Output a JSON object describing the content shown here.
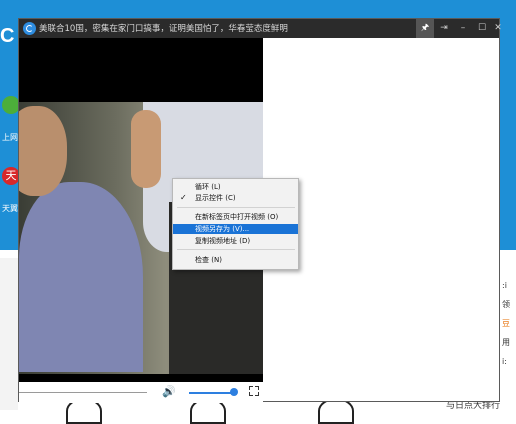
{
  "background": {
    "logo": "C",
    "apps": [
      {
        "label": "上网",
        "icon": "green-app-icon"
      },
      {
        "label": "天翼",
        "glyph": "天",
        "icon": "red-app-icon"
      }
    ],
    "right_column": [
      ":i",
      "领",
      "豆",
      "用",
      "i:"
    ],
    "bottom_text": "与日点大排行"
  },
  "window": {
    "title": "美联合10国，密集在家门口搞事，证明美国怕了，华春莹态度鲜明",
    "buttons": {
      "pin": "🖈",
      "exit": "⇥",
      "minimize": "–",
      "maximize": "☐",
      "close": "✕"
    }
  },
  "player": {
    "volume_icon": "🔊",
    "volume_level": 0.95,
    "progress": 0.0
  },
  "context_menu": {
    "items": [
      {
        "label": "循环 (L)",
        "checked": false
      },
      {
        "label": "显示控件 (C)",
        "checked": true
      },
      {
        "label": "在新标签页中打开视频 (O)",
        "checked": false
      },
      {
        "label": "视频另存为 (V)...",
        "checked": false,
        "highlighted": true
      },
      {
        "label": "复制视频地址 (D)",
        "checked": false
      },
      {
        "label": "检查 (N)",
        "checked": false
      }
    ],
    "check_glyph": "✓"
  },
  "colors": {
    "titlebar": "#2b2b2b",
    "menu_highlight": "#1a73d6",
    "volume": "#2d7fe0"
  }
}
